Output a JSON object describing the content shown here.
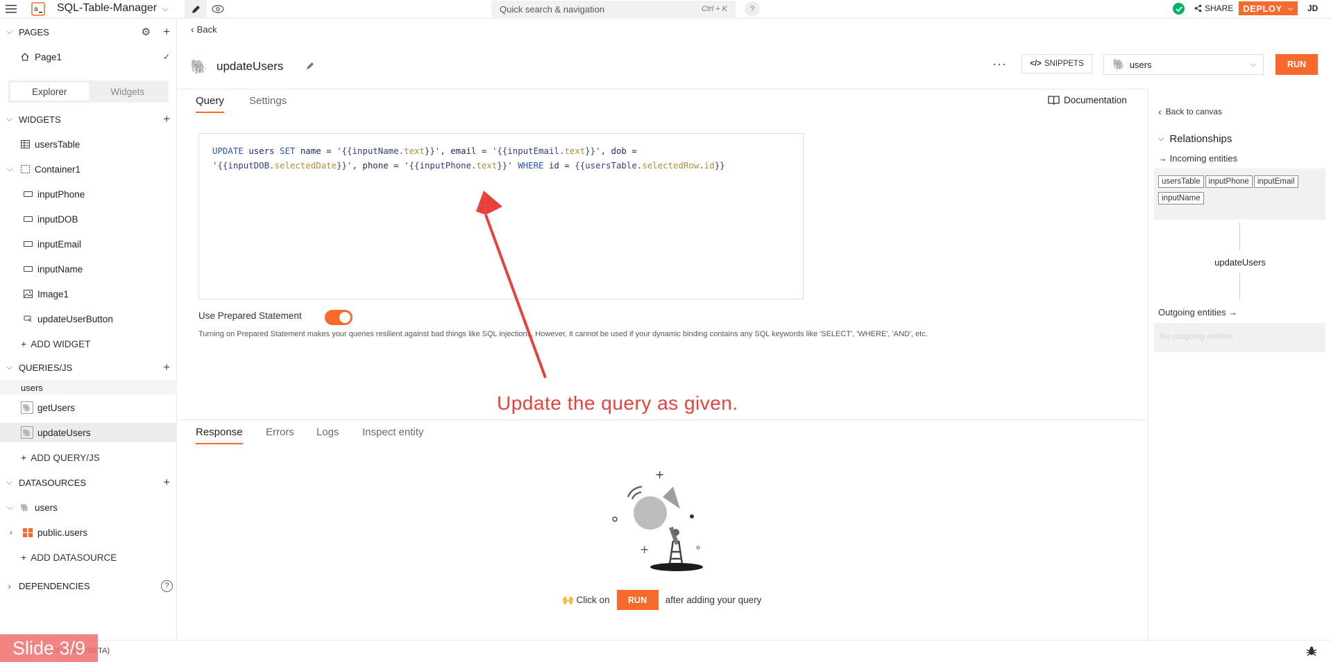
{
  "topbar": {
    "app_name": "SQL-Table-Manager",
    "search_placeholder": "Quick search & navigation",
    "search_shortcut": "Ctrl + K",
    "help": "?",
    "share": "SHARE",
    "deploy": "DEPLOY",
    "user_initials": "JD"
  },
  "sidebar": {
    "pages_header": "PAGES",
    "page1": "Page1",
    "tabs": [
      "Explorer",
      "Widgets"
    ],
    "widgets_header": "WIDGETS",
    "widgets": [
      "usersTable",
      "Container1",
      "inputPhone",
      "inputDOB",
      "inputEmail",
      "inputName",
      "Image1",
      "updateUserButton"
    ],
    "add_widget": "ADD WIDGET",
    "queries_header": "QUERIES/JS",
    "query_group": "users",
    "queries": [
      "getUsers",
      "updateUsers"
    ],
    "add_query": "ADD QUERY/JS",
    "datasources_header": "DATASOURCES",
    "datasource": "users",
    "datasource_child": "public.users",
    "add_datasource": "ADD DATASOURCE",
    "dependencies_header": "DEPENDENCIES"
  },
  "query": {
    "back": "Back",
    "name": "updateUsers",
    "snippets": "SNIPPETS",
    "datasource": "users",
    "run": "RUN",
    "tabs": [
      "Query",
      "Settings"
    ],
    "documentation": "Documentation",
    "code": {
      "l1_a": "UPDATE",
      "l1_b": " users ",
      "l1_c": "SET",
      "l1_d": " name = ",
      "l1_e": "'{{inputName.",
      "l1_f": "text",
      "l1_g": "}}'",
      "l1_h": ", email = ",
      "l1_i": "'{{inputEmail.",
      "l1_j": "text",
      "l1_k": "}}'",
      "l1_l": ", dob =",
      "l2_a": "'{{inputDOB.",
      "l2_b": "selectedDate",
      "l2_c": "}}'",
      "l2_d": ", phone = ",
      "l2_e": "'{{inputPhone.",
      "l2_f": "text",
      "l2_g": "}}'",
      "l2_h": " WHERE",
      "l2_i": " id = ",
      "l2_j": "{{usersTable.",
      "l2_k": "selectedRow",
      "l2_l": ".",
      "l2_m": "id",
      "l2_n": "}}"
    },
    "prepared_label": "Use Prepared Statement",
    "prepared_on": true,
    "prepared_help": "Turning on Prepared Statement makes your queries resilient against bad things like SQL injections. However, it cannot be used if your dynamic binding contains any SQL keywords like 'SELECT', 'WHERE', 'AND', etc."
  },
  "annotation": "Update the query as given.",
  "response": {
    "tabs": [
      "Response",
      "Errors",
      "Logs",
      "Inspect entity"
    ],
    "click_on": "🙌 Click on",
    "run": "RUN",
    "after": "after adding your query"
  },
  "right_pane": {
    "back_to_canvas": "Back to canvas",
    "relationships": "Relationships",
    "incoming": "→ Incoming entities",
    "incoming_chips": [
      "usersTable",
      "inputPhone",
      "inputEmail",
      "inputName"
    ],
    "current": "updateUsers",
    "outgoing": "Outgoing entities →",
    "no_outgoing": "No outgoing entities"
  },
  "footer": {
    "slide": "Slide 3/9",
    "beta": "CONSOLE (BETA)"
  },
  "colors": {
    "accent": "#f86a2b",
    "success": "#03b365",
    "annotation": "#e8413c"
  }
}
